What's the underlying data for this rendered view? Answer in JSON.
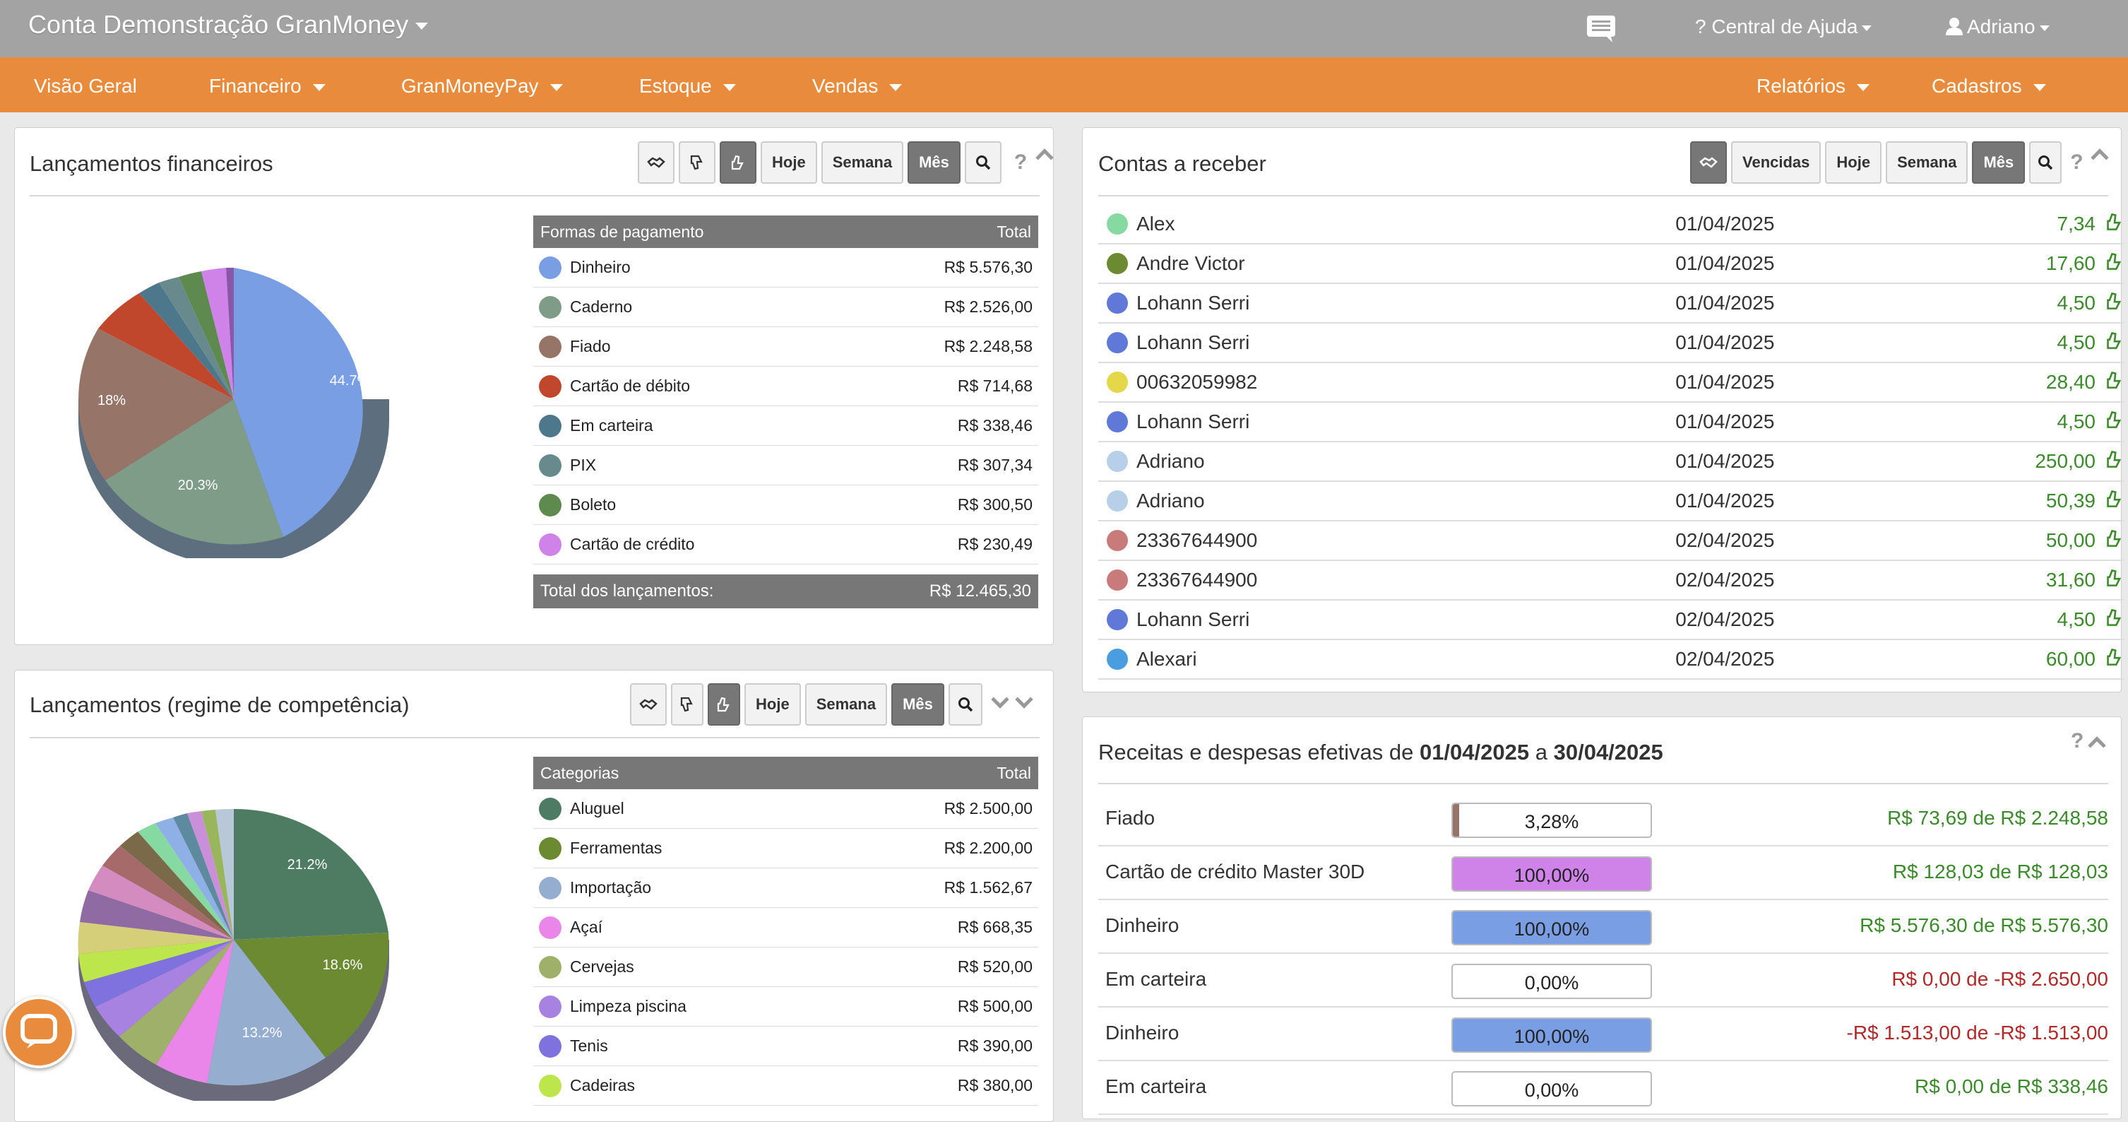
{
  "header": {
    "title": "Conta Demonstração GranMoney",
    "help": "? Central de Ajuda",
    "user": "Adriano"
  },
  "nav": {
    "left": [
      "Visão Geral",
      "Financeiro",
      "GranMoneyPay",
      "Estoque",
      "Vendas"
    ],
    "right": [
      "Relatórios",
      "Cadastros"
    ]
  },
  "lancamentos": {
    "title": "Lançamentos financeiros",
    "buttons": {
      "hoje": "Hoje",
      "semana": "Semana",
      "mes": "Mês"
    },
    "table_header": {
      "label": "Formas de pagamento",
      "total": "Total"
    },
    "rows": [
      {
        "label": "Dinheiro",
        "value": "R$ 5.576,30",
        "color": "#7a9ee3"
      },
      {
        "label": "Caderno",
        "value": "R$ 2.526,00",
        "color": "#7e9c87"
      },
      {
        "label": "Fiado",
        "value": "R$ 2.248,58",
        "color": "#967568"
      },
      {
        "label": "Cartão de débito",
        "value": "R$ 714,68",
        "color": "#c0462c"
      },
      {
        "label": "Em carteira",
        "value": "R$ 338,46",
        "color": "#4d788c"
      },
      {
        "label": "PIX",
        "value": "R$ 307,34",
        "color": "#688a8c"
      },
      {
        "label": "Boleto",
        "value": "R$ 300,50",
        "color": "#5e8a4f"
      },
      {
        "label": "Cartão de crédito",
        "value": "R$ 230,49",
        "color": "#cf82e8"
      }
    ],
    "footer_label": "Total dos lançamentos:",
    "footer_value": "R$ 12.465,30",
    "pie_labels": [
      "44.7%",
      "20.3%",
      "18%"
    ]
  },
  "competencia": {
    "title": "Lançamentos (regime de competência)",
    "buttons": {
      "hoje": "Hoje",
      "semana": "Semana",
      "mes": "Mês"
    },
    "table_header": {
      "label": "Categorias",
      "total": "Total"
    },
    "rows": [
      {
        "label": "Aluguel",
        "value": "R$ 2.500,00",
        "color": "#4d7c63"
      },
      {
        "label": "Ferramentas",
        "value": "R$ 2.200,00",
        "color": "#6b8a32"
      },
      {
        "label": "Importação",
        "value": "R$ 1.562,67",
        "color": "#95aed0"
      },
      {
        "label": "Açaí",
        "value": "R$ 668,35",
        "color": "#ea86ea"
      },
      {
        "label": "Cervejas",
        "value": "R$ 520,00",
        "color": "#9fb06a"
      },
      {
        "label": "Limpeza piscina",
        "value": "R$ 500,00",
        "color": "#a882e0"
      },
      {
        "label": "Tenis",
        "value": "R$ 390,00",
        "color": "#7f72de"
      },
      {
        "label": "Cadeiras",
        "value": "R$ 380,00",
        "color": "#bde64c"
      }
    ],
    "pie_labels": [
      "21.2%",
      "18.6%",
      "13.2%"
    ]
  },
  "contas": {
    "title": "Contas a receber",
    "buttons": {
      "vencidas": "Vencidas",
      "hoje": "Hoje",
      "semana": "Semana",
      "mes": "Mês"
    },
    "rows": [
      {
        "name": "Alex",
        "date": "01/04/2025",
        "amount": "7,34",
        "color": "#86d9a1"
      },
      {
        "name": "Andre Victor",
        "date": "01/04/2025",
        "amount": "17,60",
        "color": "#6b8a32"
      },
      {
        "name": "Lohann Serri",
        "date": "01/04/2025",
        "amount": "4,50",
        "color": "#6079d8"
      },
      {
        "name": "Lohann Serri",
        "date": "01/04/2025",
        "amount": "4,50",
        "color": "#6079d8"
      },
      {
        "name": "00632059982",
        "date": "01/04/2025",
        "amount": "28,40",
        "color": "#e4d84a"
      },
      {
        "name": "Lohann Serri",
        "date": "01/04/2025",
        "amount": "4,50",
        "color": "#6079d8"
      },
      {
        "name": "Adriano",
        "date": "01/04/2025",
        "amount": "250,00",
        "color": "#b7cfe9"
      },
      {
        "name": "Adriano",
        "date": "01/04/2025",
        "amount": "50,39",
        "color": "#b7cfe9"
      },
      {
        "name": "23367644900",
        "date": "02/04/2025",
        "amount": "50,00",
        "color": "#c97a7a"
      },
      {
        "name": "23367644900",
        "date": "02/04/2025",
        "amount": "31,60",
        "color": "#c97a7a"
      },
      {
        "name": "Lohann Serri",
        "date": "02/04/2025",
        "amount": "4,50",
        "color": "#6079d8"
      },
      {
        "name": "Alexari",
        "date": "02/04/2025",
        "amount": "60,00",
        "color": "#4a9ee0"
      }
    ]
  },
  "receitas": {
    "title_prefix": "Receitas e despesas efetivas de",
    "date_from": "01/04/2025",
    "title_mid": "a",
    "date_to": "30/04/2025",
    "rows": [
      {
        "label": "Fiado",
        "percent": "3,28%",
        "fill": 0.0328,
        "fill_color": "#967568",
        "value": "R$ 73,69 de R$ 2.248,58",
        "value_color": "#3b8a2b"
      },
      {
        "label": "Cartão de crédito Master 30D",
        "percent": "100,00%",
        "fill": 1,
        "fill_color": "#cf82e8",
        "value": "R$ 128,03 de R$ 128,03",
        "value_color": "#3b8a2b"
      },
      {
        "label": "Dinheiro",
        "percent": "100,00%",
        "fill": 1,
        "fill_color": "#7a9ee3",
        "value": "R$ 5.576,30 de R$ 5.576,30",
        "value_color": "#3b8a2b"
      },
      {
        "label": "Em carteira",
        "percent": "0,00%",
        "fill": 0,
        "fill_color": "#4d788c",
        "value": "R$ 0,00 de -R$ 2.650,00",
        "value_color": "#b02a2a"
      },
      {
        "label": "Dinheiro",
        "percent": "100,00%",
        "fill": 1,
        "fill_color": "#7a9ee3",
        "value": "-R$ 1.513,00 de -R$ 1.513,00",
        "value_color": "#b02a2a"
      },
      {
        "label": "Em carteira",
        "percent": "0,00%",
        "fill": 0,
        "fill_color": "#4d788c",
        "value": "R$ 0,00 de R$ 338,46",
        "value_color": "#3b8a2b"
      }
    ]
  }
}
